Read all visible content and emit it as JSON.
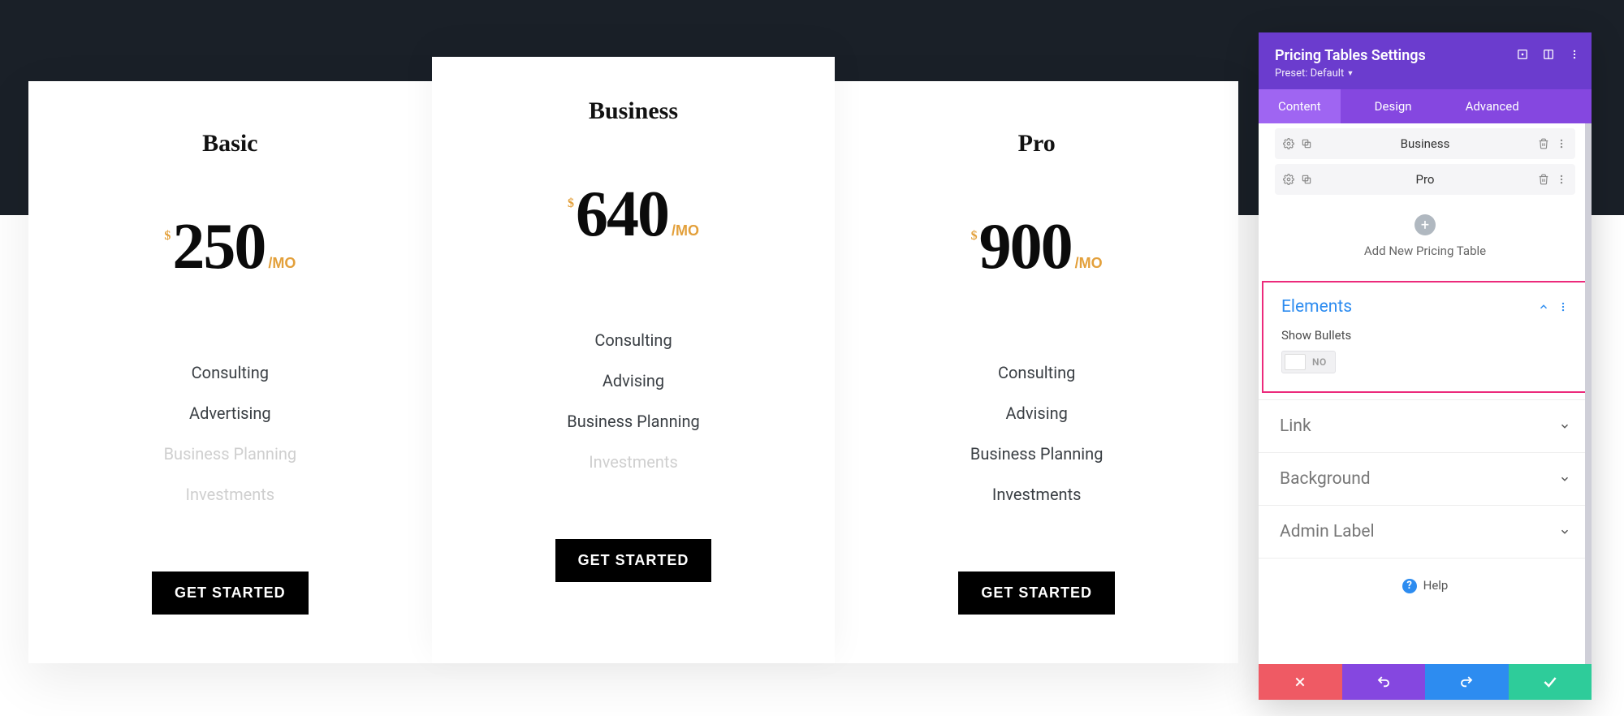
{
  "plans": [
    {
      "name": "Basic",
      "currency": "$",
      "amount": "250",
      "period": "/MO",
      "features": [
        {
          "label": "Consulting",
          "muted": false
        },
        {
          "label": "Advertising",
          "muted": false
        },
        {
          "label": "Business Planning",
          "muted": true
        },
        {
          "label": "Investments",
          "muted": true
        }
      ],
      "cta": "GET STARTED",
      "featured": false
    },
    {
      "name": "Business",
      "currency": "$",
      "amount": "640",
      "period": "/MO",
      "features": [
        {
          "label": "Consulting",
          "muted": false
        },
        {
          "label": "Advising",
          "muted": false
        },
        {
          "label": "Business Planning",
          "muted": false
        },
        {
          "label": "Investments",
          "muted": true
        }
      ],
      "cta": "GET STARTED",
      "featured": true
    },
    {
      "name": "Pro",
      "currency": "$",
      "amount": "900",
      "period": "/MO",
      "features": [
        {
          "label": "Consulting",
          "muted": false
        },
        {
          "label": "Advising",
          "muted": false
        },
        {
          "label": "Business Planning",
          "muted": false
        },
        {
          "label": "Investments",
          "muted": false
        }
      ],
      "cta": "GET STARTED",
      "featured": false
    }
  ],
  "panel": {
    "title": "Pricing Tables Settings",
    "preset_label": "Preset: Default",
    "tabs": {
      "content": "Content",
      "design": "Design",
      "advanced": "Advanced",
      "active": "content"
    },
    "items": [
      {
        "label": "Business"
      },
      {
        "label": "Pro"
      }
    ],
    "add_new_label": "Add New Pricing Table",
    "elements": {
      "title": "Elements",
      "show_bullets_label": "Show Bullets",
      "show_bullets_state": "NO"
    },
    "sections": {
      "link": "Link",
      "background": "Background",
      "admin_label": "Admin Label"
    },
    "help_label": "Help"
  }
}
